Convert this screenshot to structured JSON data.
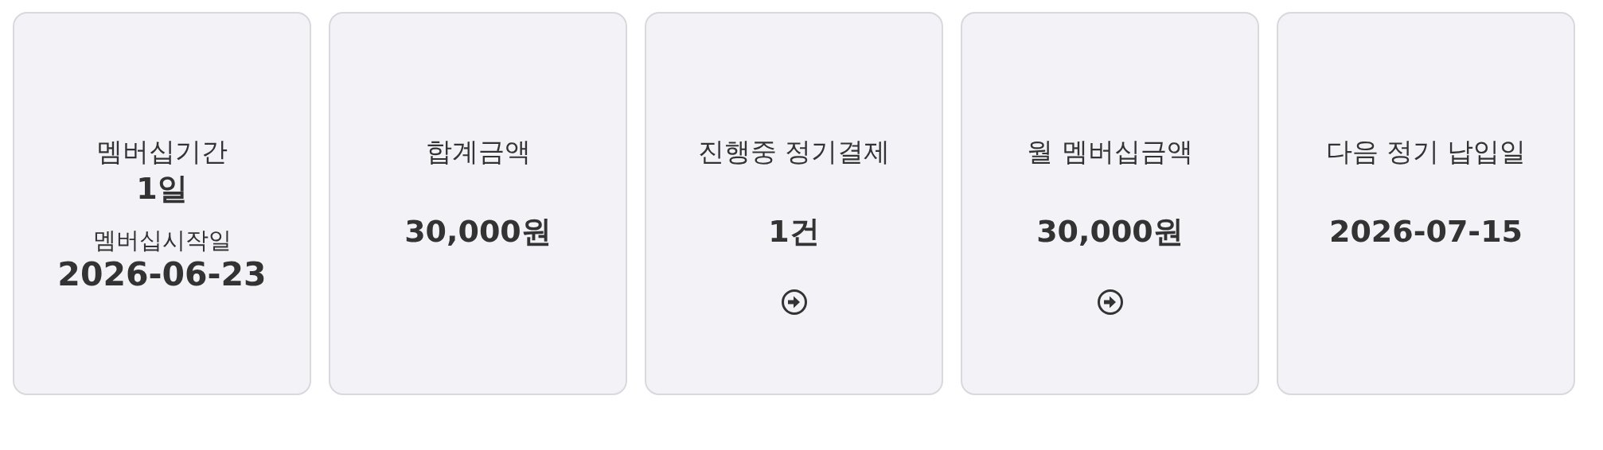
{
  "cards": [
    {
      "kind": "period",
      "title": "멤버십기간",
      "value": "1일",
      "sub_label": "멤버십시작일",
      "sub_value": "2026-06-23"
    },
    {
      "kind": "stat",
      "title": "합계금액",
      "value": "30,000원",
      "has_link": false
    },
    {
      "kind": "stat",
      "title": "진행중 정기결제",
      "value": "1건",
      "has_link": true
    },
    {
      "kind": "stat",
      "title": "월 멤버십금액",
      "value": "30,000원",
      "has_link": true
    },
    {
      "kind": "stat",
      "title": "다음 정기 납입일",
      "value": "2026-07-15",
      "has_link": false
    }
  ]
}
